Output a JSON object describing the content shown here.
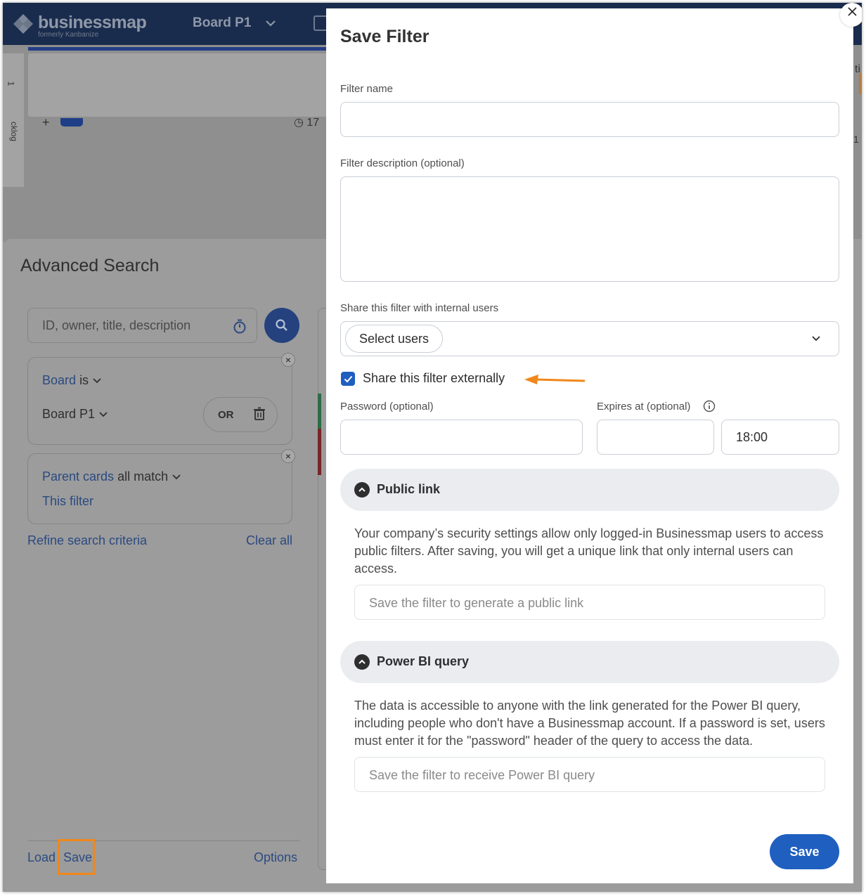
{
  "topbar": {
    "logo_text": "businessmap",
    "logo_sub": "formerly Kanbanize",
    "board_title": "Board P1"
  },
  "board_bg": {
    "lane_number": "1",
    "lane_name": "cklog",
    "add_symbol": "+",
    "timer_text": "17",
    "right_number": "1",
    "right_letter": "ti"
  },
  "advanced_search": {
    "title": "Advanced Search",
    "search_placeholder": "ID, owner, title, description",
    "criteria": [
      {
        "field": "Board",
        "operator": "is",
        "value": "Board P1",
        "or_label": "OR"
      },
      {
        "field": "Parent cards",
        "operator": "all match",
        "value": "This filter"
      }
    ],
    "refine_label": "Refine search criteria",
    "clear_all_label": "Clear all",
    "footer": {
      "load": "Load",
      "save": "Save",
      "options": "Options"
    },
    "highlight_color": "#f0871a"
  },
  "modal": {
    "title": "Save Filter",
    "filter_name_label": "Filter name",
    "filter_name_value": "",
    "filter_description_label": "Filter description (optional)",
    "filter_description_value": "",
    "share_internal_label": "Share this filter with internal users",
    "select_users_chip": "Select users",
    "share_external_label": "Share this filter externally",
    "share_external_checked": true,
    "password_label": "Password (optional)",
    "password_value": "",
    "expires_label": "Expires at (optional)",
    "expires_date": "",
    "expires_time": "18:00",
    "public_link": {
      "title": "Public link",
      "text": "Your company’s security settings allow only logged-in Businessmap users to access public filters. After saving, you will get a unique link that only internal users can access.",
      "placeholder": "Save the filter to generate a public link"
    },
    "power_bi": {
      "title": "Power BI query",
      "text": "The data is accessible to anyone with the link generated for the Power BI query, including people who don't have a Businessmap account. If a password is set, users must enter it for the \"password\" header of the query to access the data.",
      "placeholder": "Save the filter to receive Power BI query"
    },
    "save_label": "Save",
    "accent_color": "#1f5fbf",
    "arrow_color": "#f0871a"
  }
}
